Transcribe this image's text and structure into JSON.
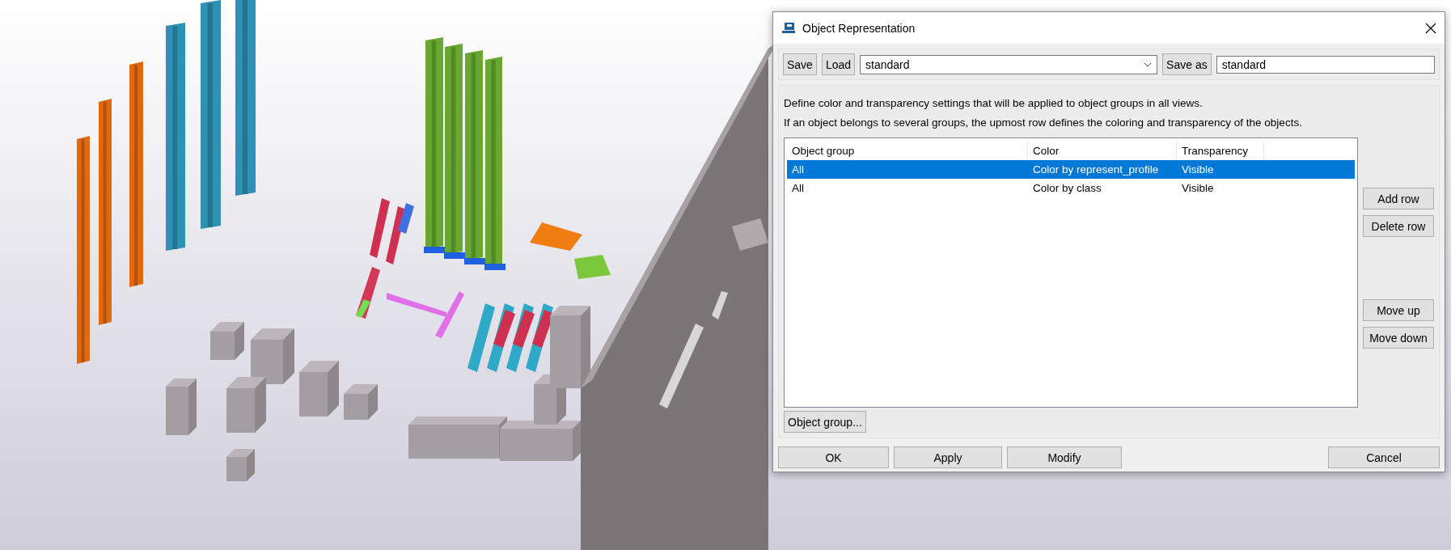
{
  "window": {
    "title": "Object Representation"
  },
  "toolbar": {
    "save": "Save",
    "load": "Load",
    "settings": "standard",
    "save_as": "Save as",
    "save_as_name": "standard"
  },
  "description": [
    "Define color and transparency settings that will be applied to object groups in all views.",
    "If an object belongs to several groups, the upmost row defines the coloring and transparency of the objects."
  ],
  "table": {
    "columns": [
      "Object group",
      "Color",
      "Transparency"
    ],
    "rows": [
      {
        "cells": [
          "All",
          "Color by represent_profile",
          "Visible"
        ],
        "selected": true
      },
      {
        "cells": [
          "All",
          "Color by class",
          "Visible"
        ],
        "selected": false
      }
    ]
  },
  "row_buttons": [
    "Add row",
    "Delete row"
  ],
  "order_buttons": [
    "Move up",
    "Move down"
  ],
  "object_group_button": "Object group...",
  "buttons": [
    {
      "label": "OK"
    },
    {
      "label": "Apply"
    },
    {
      "label": "Modify"
    },
    {
      "label": "Cancel"
    }
  ]
}
